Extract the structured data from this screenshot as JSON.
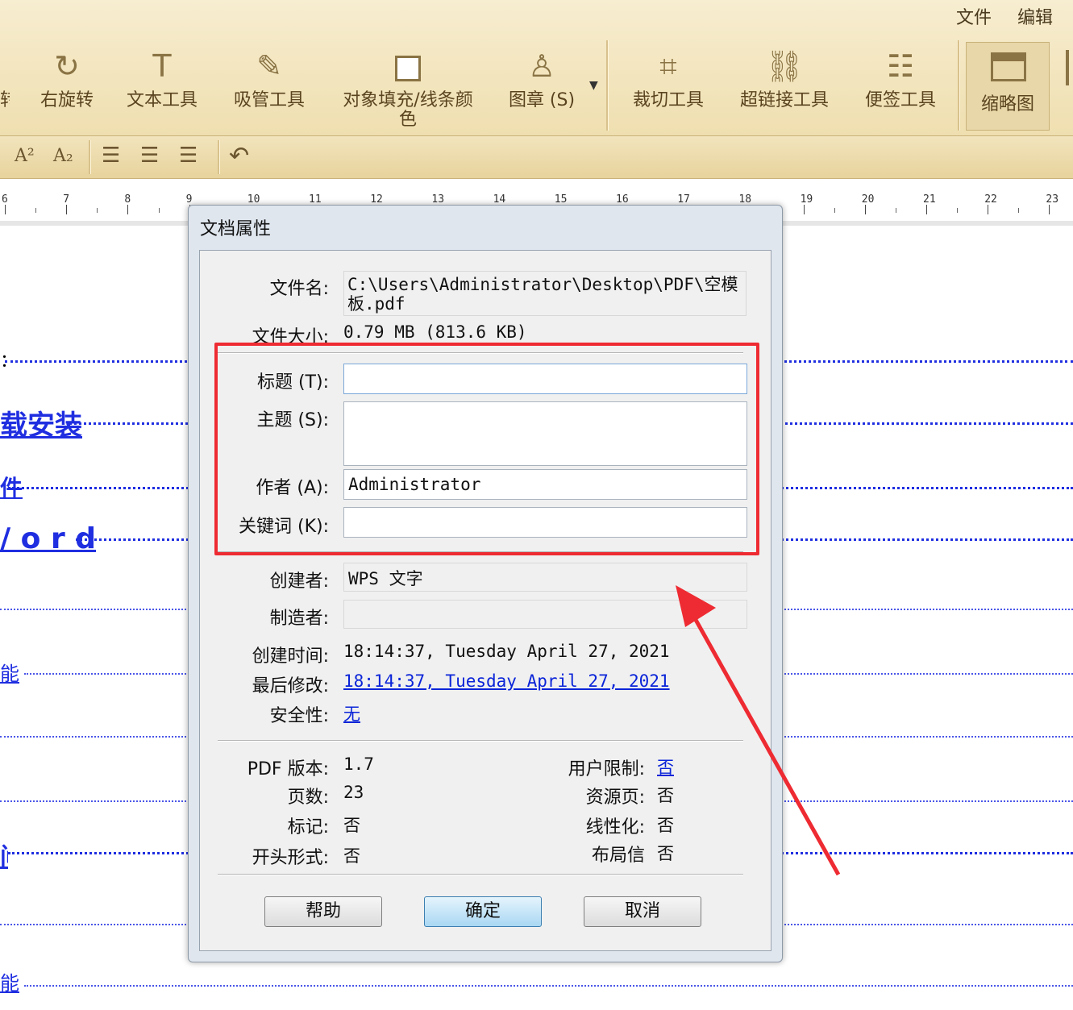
{
  "menu": {
    "file": "文件",
    "edit": "编辑"
  },
  "toolbar": {
    "items": [
      {
        "label": "转",
        "icon": "rotate-left-icon"
      },
      {
        "label": "右旋转",
        "icon": "rotate-right-icon",
        "glyph": "↻"
      },
      {
        "label": "文本工具",
        "icon": "text-tool-icon",
        "glyph": "T"
      },
      {
        "label": "吸管工具",
        "icon": "eyedropper-icon",
        "glyph": "✎"
      },
      {
        "label": "对象填充/线条颜",
        "label2": "色",
        "icon": "fill-color-icon"
      },
      {
        "label": "图章 (S)",
        "icon": "stamp-icon",
        "glyph": "♙"
      },
      {
        "label": "裁切工具",
        "icon": "crop-icon",
        "glyph": "⌗"
      },
      {
        "label": "超链接工具",
        "icon": "link-icon",
        "glyph": "⛓"
      },
      {
        "label": "便签工具",
        "icon": "note-icon",
        "glyph": "☷"
      },
      {
        "label": "缩略图",
        "icon": "thumbnail-icon"
      }
    ]
  },
  "format": {
    "sup": "A²",
    "sub": "A₂"
  },
  "ruler": {
    "numbers": [
      "6",
      "7",
      "8",
      "9",
      "10",
      "11",
      "12",
      "13",
      "14",
      "15",
      "16",
      "17",
      "18",
      "19",
      "20",
      "21",
      "22",
      "23"
    ]
  },
  "background_doc": {
    "texts": [
      "：",
      "载安装",
      "件",
      "/ o r d",
      "能",
      "间",
      "能"
    ]
  },
  "dialog": {
    "title": "文档属性",
    "filename_label": "文件名:",
    "filename_value": "C:\\Users\\Administrator\\Desktop\\PDF\\空模板.pdf",
    "filesize_label": "文件大小:",
    "filesize_value": "0.79 MB (813.6 KB)",
    "title_field_label": "标题 (T):",
    "title_field_value": "",
    "subject_label": "主题 (S):",
    "subject_value": "",
    "author_label": "作者 (A):",
    "author_value": "Administrator",
    "keywords_label": "关键词 (K):",
    "keywords_value": "",
    "creator_label": "创建者:",
    "creator_value": "WPS 文字",
    "producer_label": "制造者:",
    "producer_value": "",
    "created_label": "创建时间:",
    "created_value": "18:14:37, Tuesday April 27, 2021",
    "modified_label": "最后修改:",
    "modified_value": "18:14:37, Tuesday April 27, 2021",
    "security_label": "安全性:",
    "security_value": "无",
    "pdf_version_label": "PDF 版本:",
    "pdf_version_value": "1.7",
    "pages_label": "页数:",
    "pages_value": "23",
    "tagged_label": "标记:",
    "tagged_value": "否",
    "opening_label": "开头形式:",
    "opening_value": "否",
    "user_restrict_label": "用户限制:",
    "user_restrict_value": "否",
    "resource_label": "资源页:",
    "resource_value": "否",
    "linearized_label": "线性化:",
    "linearized_value": "否",
    "layout_label": "布局信",
    "layout_value": "否",
    "help_button": "帮助",
    "ok_button": "确定",
    "cancel_button": "取消"
  },
  "colors": {
    "annotation": "#ee2b32",
    "link": "#0a24d8",
    "toolbar": "#efdfb0"
  }
}
